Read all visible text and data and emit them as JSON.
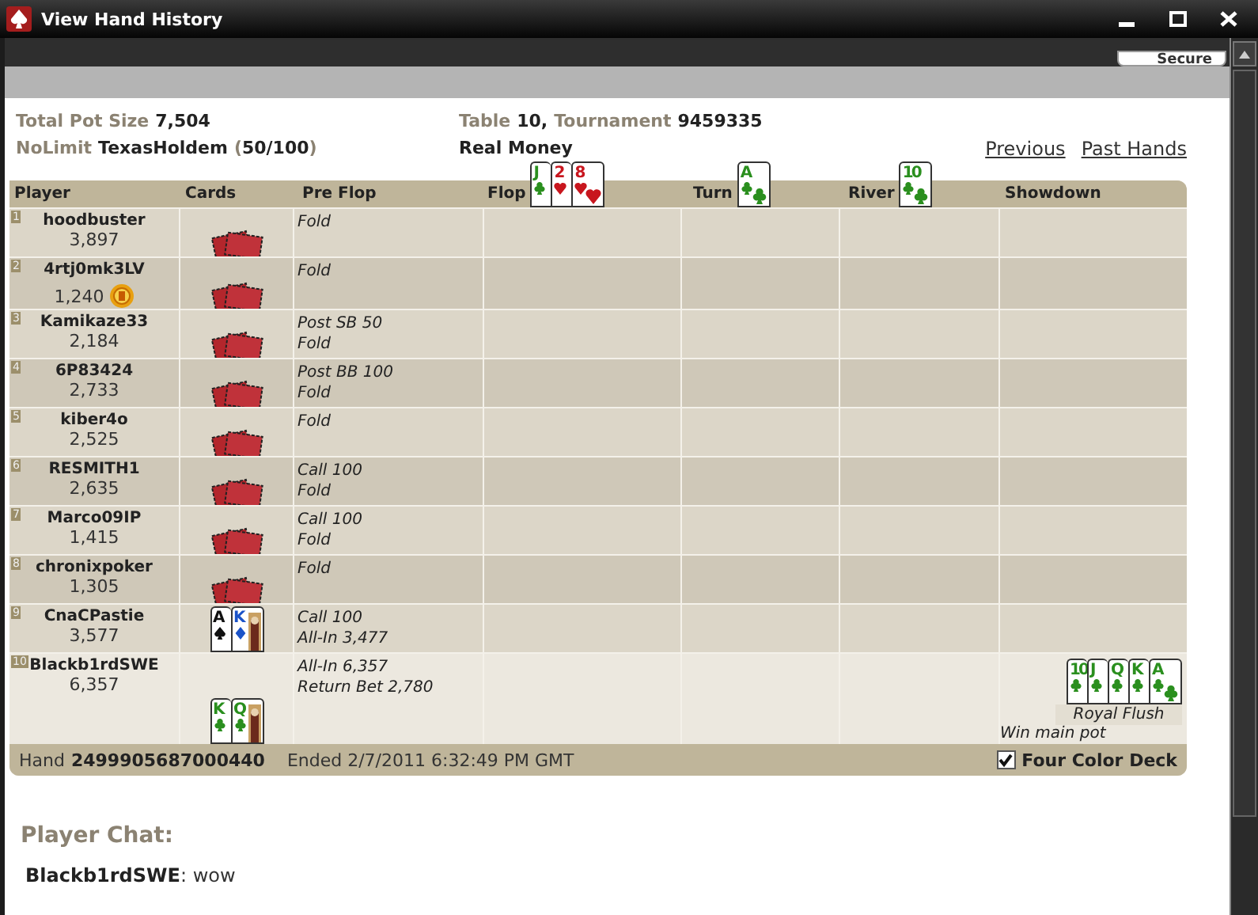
{
  "window": {
    "title": "View Hand History"
  },
  "secure_button": "Secure",
  "summary": {
    "pot_label": "Total Pot Size",
    "pot_value": "7,504",
    "limit_label": "NoLimit",
    "game": "TexasHoldem",
    "stakes_open": "(",
    "stakes": "50/100",
    "stakes_close": ")",
    "table_label": "Table",
    "table_value": "10,",
    "tournament_label": "Tournament",
    "tournament_value": "9459335",
    "money": "Real Money"
  },
  "links": [
    "Previous",
    "Past Hands"
  ],
  "columns": [
    "Player",
    "Cards",
    "Pre Flop",
    "Flop",
    "Turn",
    "River",
    "Showdown"
  ],
  "board": {
    "flop": [
      {
        "rank": "J",
        "kind": "clubs"
      },
      {
        "rank": "2",
        "kind": "hearts"
      },
      {
        "rank": "8",
        "kind": "hearts"
      }
    ],
    "turn": [
      {
        "rank": "A",
        "kind": "clubs"
      }
    ],
    "river": [
      {
        "rank": "10",
        "kind": "clubs"
      }
    ]
  },
  "players": [
    {
      "seat": "1",
      "name": "hoodbuster",
      "chips": "3,897",
      "dealer": false,
      "winner": false,
      "actions": [
        "Fold"
      ]
    },
    {
      "seat": "2",
      "name": "4rtj0mk3LV",
      "chips": "1,240",
      "dealer": true,
      "winner": false,
      "actions": [
        "Fold"
      ]
    },
    {
      "seat": "3",
      "name": "Kamikaze33",
      "chips": "2,184",
      "dealer": false,
      "winner": false,
      "actions": [
        "Post SB 50",
        "Fold"
      ]
    },
    {
      "seat": "4",
      "name": "6P83424",
      "chips": "2,733",
      "dealer": false,
      "winner": false,
      "actions": [
        "Post BB 100",
        "Fold"
      ]
    },
    {
      "seat": "5",
      "name": "kiber4o",
      "chips": "2,525",
      "dealer": false,
      "winner": false,
      "actions": [
        "Fold"
      ]
    },
    {
      "seat": "6",
      "name": "RESMITH1",
      "chips": "2,635",
      "dealer": false,
      "winner": false,
      "actions": [
        "Call 100",
        "Fold"
      ]
    },
    {
      "seat": "7",
      "name": "Marco09IP",
      "chips": "1,415",
      "dealer": false,
      "winner": false,
      "actions": [
        "Call 100",
        "Fold"
      ]
    },
    {
      "seat": "8",
      "name": "chronixpoker",
      "chips": "1,305",
      "dealer": false,
      "winner": false,
      "actions": [
        "Fold"
      ]
    },
    {
      "seat": "9",
      "name": "CnaCPastie",
      "chips": "3,577",
      "dealer": false,
      "winner": false,
      "cards": [
        {
          "rank": "A",
          "kind": "spades"
        },
        {
          "rank": "K",
          "kind": "diamonds"
        }
      ],
      "actions": [
        "Call 100",
        "All-In 3,477"
      ]
    },
    {
      "seat": "10",
      "name": "Blackb1rdSWE",
      "chips": "6,357",
      "dealer": false,
      "winner": true,
      "cards": [
        {
          "rank": "K",
          "kind": "clubs"
        },
        {
          "rank": "Q",
          "kind": "clubs"
        }
      ],
      "actions": [
        "All-In 6,357",
        "Return Bet 2,780"
      ],
      "showdown": {
        "cards": [
          {
            "rank": "10",
            "kind": "clubs"
          },
          {
            "rank": "J",
            "kind": "clubs"
          },
          {
            "rank": "Q",
            "kind": "clubs"
          },
          {
            "rank": "K",
            "kind": "clubs"
          },
          {
            "rank": "A",
            "kind": "clubs"
          }
        ],
        "hand": "Royal Flush",
        "result": "Win main pot"
      }
    }
  ],
  "footer": {
    "hand_label": "Hand",
    "hand_number": "2499905687000440",
    "ended": "Ended 2/7/2011 6:32:49 PM GMT",
    "four_color": {
      "label": "Four Color Deck",
      "checked": true
    }
  },
  "chat": {
    "title": "Player Chat:",
    "messages": [
      "**Blackb1rdSWE**: wow"
    ]
  }
}
